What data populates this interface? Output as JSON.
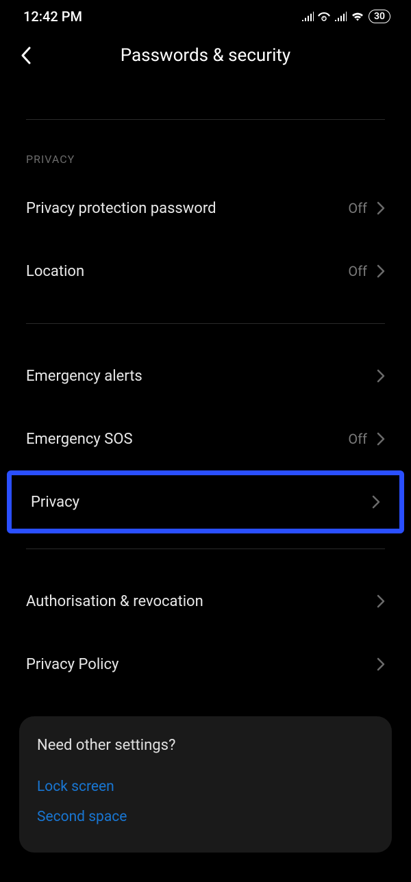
{
  "status": {
    "time": "12:42 PM",
    "battery": "30"
  },
  "header": {
    "title": "Passwords & security"
  },
  "section": {
    "privacy_label": "PRIVACY"
  },
  "rows": {
    "privacy_protection": {
      "label": "Privacy protection password",
      "value": "Off"
    },
    "location": {
      "label": "Location",
      "value": "Off"
    },
    "emergency_alerts": {
      "label": "Emergency alerts"
    },
    "emergency_sos": {
      "label": "Emergency SOS",
      "value": "Off"
    },
    "privacy": {
      "label": "Privacy"
    },
    "authorisation": {
      "label": "Authorisation & revocation"
    },
    "privacy_policy": {
      "label": "Privacy Policy"
    }
  },
  "card": {
    "title": "Need other settings?",
    "links": {
      "lock_screen": "Lock screen",
      "second_space": "Second space"
    }
  }
}
